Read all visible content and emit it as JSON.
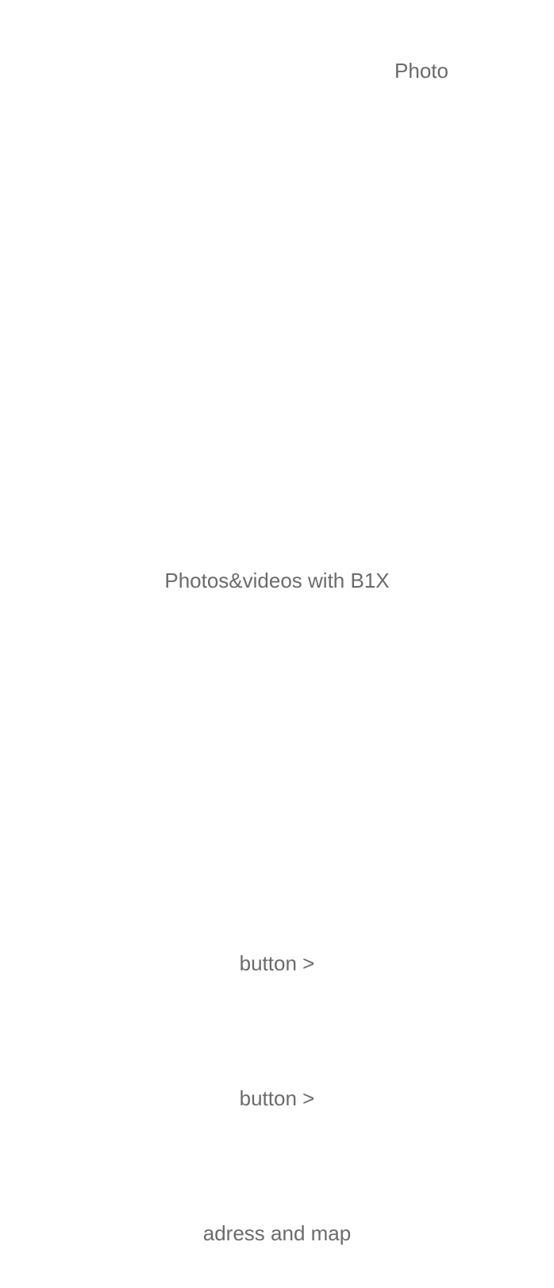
{
  "header": {
    "photo_label": "Photo"
  },
  "media": {
    "caption": "Photos&videos with B1X"
  },
  "buttons": [
    {
      "label": "button >"
    },
    {
      "label": "button >"
    }
  ],
  "footer": {
    "address_label": "adress and map"
  }
}
